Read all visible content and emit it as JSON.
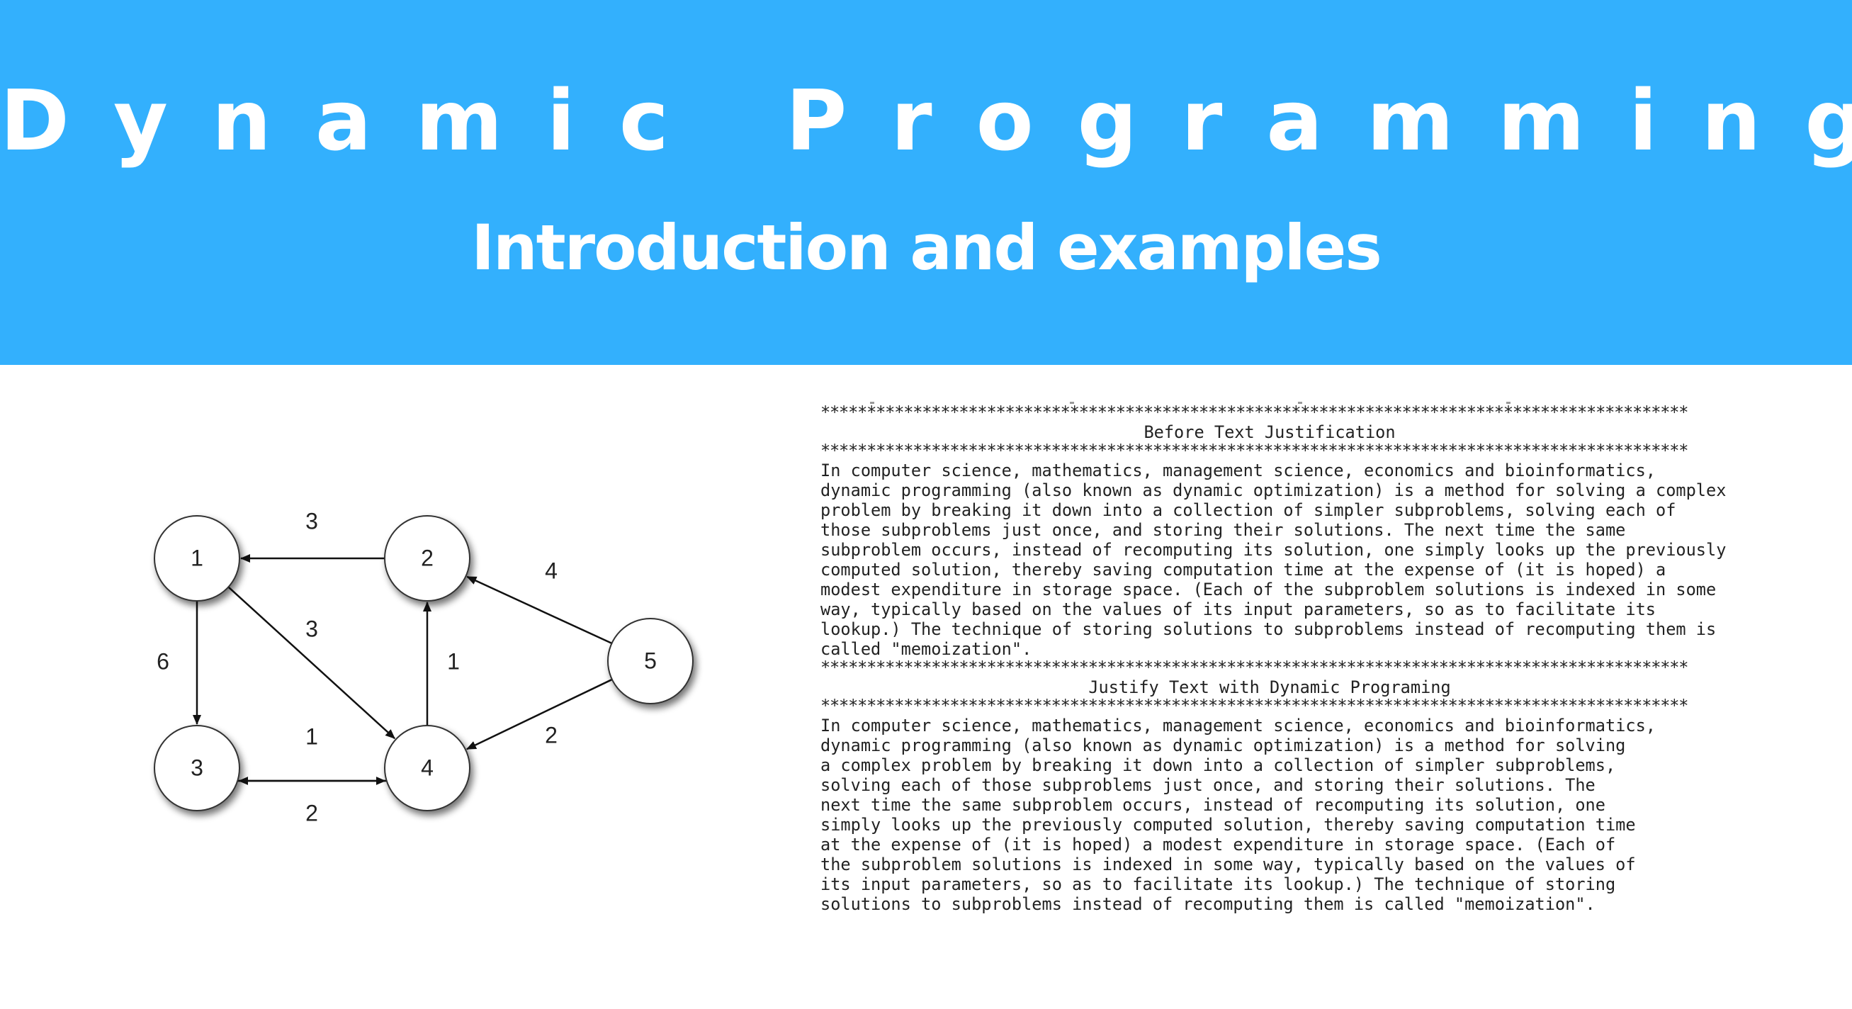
{
  "banner": {
    "title": "Dynamic Programming",
    "subtitle": "Introduction and examples",
    "color": "#33b0fd"
  },
  "graph": {
    "nodes": [
      {
        "id": "1",
        "label": "1"
      },
      {
        "id": "2",
        "label": "2"
      },
      {
        "id": "3",
        "label": "3"
      },
      {
        "id": "4",
        "label": "4"
      },
      {
        "id": "5",
        "label": "5"
      }
    ],
    "edges": [
      {
        "from": "2",
        "to": "1",
        "weight": "3"
      },
      {
        "from": "1",
        "to": "3",
        "weight": "6"
      },
      {
        "from": "1",
        "to": "4",
        "weight": "3"
      },
      {
        "from": "4",
        "to": "2",
        "weight": "1"
      },
      {
        "from": "4",
        "to": "3",
        "weight": "1"
      },
      {
        "from": "3",
        "to": "4",
        "weight": "2"
      },
      {
        "from": "5",
        "to": "2",
        "weight": "4"
      },
      {
        "from": "5",
        "to": "4",
        "weight": "2"
      }
    ]
  },
  "console": {
    "stars": "**********************************************************************************************",
    "heading_before": "Before Text Justification",
    "before_lines": [
      "In computer science, mathematics, management science, economics and bioinformatics,",
      "dynamic programming (also known as dynamic optimization) is a method for solving a complex",
      "problem by breaking it down into a collection of simpler subproblems, solving each of",
      "those subproblems just once, and storing their solutions. The next time the same",
      "subproblem occurs, instead of recomputing its solution, one simply looks up the previously",
      "computed solution, thereby saving computation time at the expense of (it is hoped) a",
      "modest expenditure in storage space. (Each of the subproblem solutions is indexed in some",
      "way, typically based on the values of its input parameters, so as to facilitate its",
      "lookup.) The technique of storing solutions to subproblems instead of recomputing them is",
      "called \"memoization\"."
    ],
    "heading_after": "Justify Text with Dynamic Programing",
    "after_lines": [
      "In computer science, mathematics, management science, economics and bioinformatics,",
      "dynamic programming (also known as dynamic optimization) is a method for solving",
      "a complex problem by breaking it down into a collection of simpler subproblems,",
      "solving each of those subproblems just once, and storing their solutions. The",
      "next time the same subproblem occurs, instead of recomputing its solution, one",
      "simply looks up the previously computed solution, thereby saving computation time",
      "at the expense of (it is hoped) a modest expenditure in storage space. (Each of",
      "the subproblem solutions is indexed in some way, typically based on the values of",
      "its input parameters, so as to facilitate its lookup.) The technique of storing",
      "solutions to subproblems instead of recomputing them is called \"memoization\"."
    ]
  }
}
